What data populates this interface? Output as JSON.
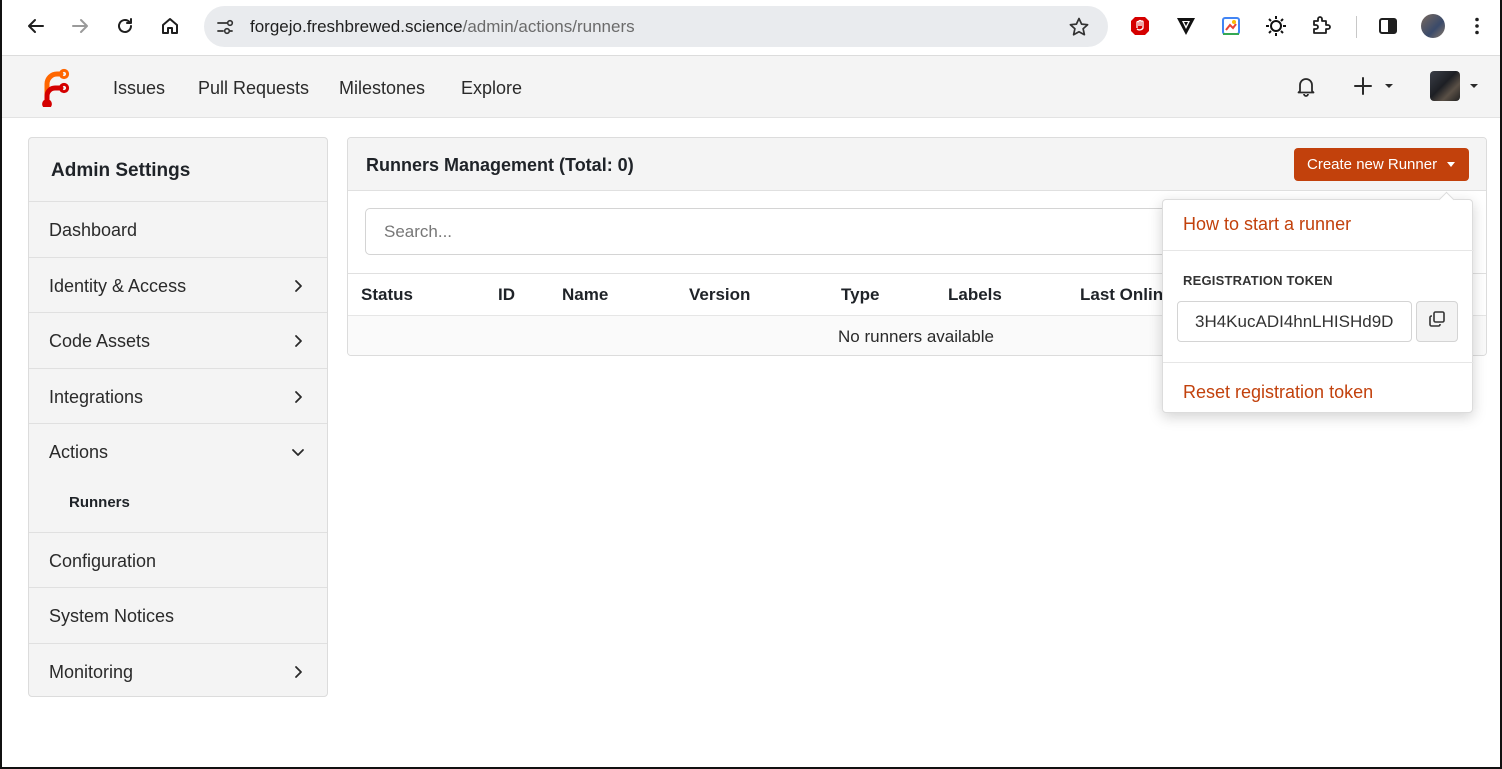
{
  "browser": {
    "url_host": "forgejo.freshbrewed.science",
    "url_path": "/admin/actions/runners"
  },
  "topnav": {
    "items": [
      {
        "label": "Issues"
      },
      {
        "label": "Pull Requests"
      },
      {
        "label": "Milestones"
      },
      {
        "label": "Explore"
      }
    ]
  },
  "sidebar": {
    "title": "Admin Settings",
    "items": [
      {
        "label": "Dashboard"
      },
      {
        "label": "Identity & Access"
      },
      {
        "label": "Code Assets"
      },
      {
        "label": "Integrations"
      },
      {
        "label": "Actions"
      },
      {
        "label": "Runners"
      },
      {
        "label": "Configuration"
      },
      {
        "label": "System Notices"
      },
      {
        "label": "Monitoring"
      }
    ]
  },
  "main": {
    "title": "Runners Management (Total: 0)",
    "create_button": "Create new Runner",
    "search_placeholder": "Search...",
    "columns": [
      "Status",
      "ID",
      "Name",
      "Version",
      "Type",
      "Labels",
      "Last Online"
    ],
    "empty_message": "No runners available"
  },
  "dropdown": {
    "how_to": "How to start a runner",
    "token_label": "REGISTRATION TOKEN",
    "token_value": "3H4KucADI4hnLHISHd9D",
    "reset": "Reset registration token"
  },
  "colors": {
    "accent": "#c2410c",
    "header_bg": "#f4f4f4"
  },
  "icons": [
    "back-icon",
    "forward-icon",
    "reload-icon",
    "home-icon",
    "site-settings-icon",
    "bookmark-star-icon",
    "bell-icon",
    "plus-icon",
    "chevron-right-icon",
    "chevron-down-icon",
    "copy-icon"
  ]
}
